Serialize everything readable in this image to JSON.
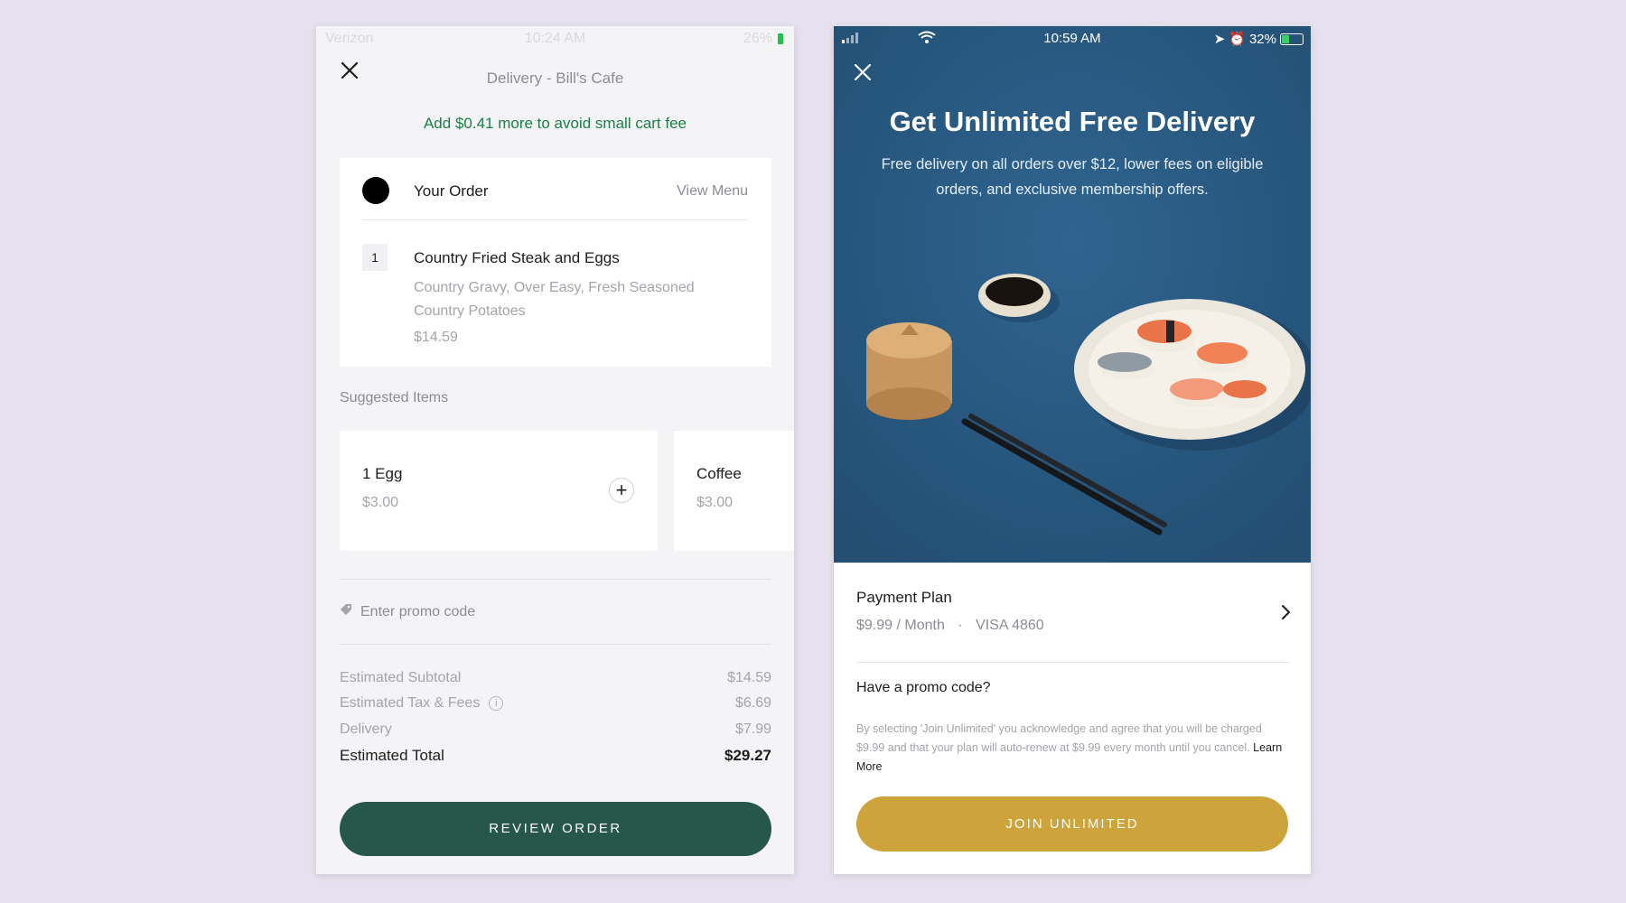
{
  "left": {
    "status": {
      "carrier": "Verizon",
      "time": "10:24 AM",
      "battery": "26%"
    },
    "title": "Delivery - Bill's Cafe",
    "banner": "Add $0.41 more to avoid small cart fee",
    "order": {
      "heading": "Your Order",
      "view_menu": "View Menu",
      "item": {
        "qty": "1",
        "name": "Country Fried Steak and Eggs",
        "desc": "Country Gravy, Over Easy, Fresh Seasoned Country Potatoes",
        "price": "$14.59"
      }
    },
    "suggested_label": "Suggested Items",
    "suggested": [
      {
        "name": "1 Egg",
        "price": "$3.00"
      },
      {
        "name": "Coffee",
        "price": "$3.00"
      }
    ],
    "promo_placeholder": "Enter promo code",
    "summary": {
      "subtotal_label": "Estimated Subtotal",
      "subtotal": "$14.59",
      "tax_label": "Estimated Tax & Fees",
      "tax": "$6.69",
      "delivery_label": "Delivery",
      "delivery": "$7.99",
      "total_label": "Estimated Total",
      "total": "$29.27"
    },
    "review_button": "REVIEW ORDER"
  },
  "right": {
    "status": {
      "time": "10:59 AM",
      "battery": "32%"
    },
    "headline": "Get Unlimited Free Delivery",
    "subhead": "Free delivery on all orders over $12, lower fees on eligible orders, and exclusive membership offers.",
    "payment": {
      "label": "Payment Plan",
      "price": "$9.99 / Month",
      "separator": "·",
      "card": "VISA 4860"
    },
    "promo_question": "Have a promo code?",
    "legal": "By selecting 'Join Unlimited' you acknowledge and agree that you will be charged $9.99 and that your plan will auto-renew at $9.99 every month until you cancel.",
    "learn_more": "Learn More",
    "join_button": "JOIN UNLIMITED"
  },
  "colors": {
    "background": "#e6e1ee",
    "primary_green": "#27574a",
    "banner_green": "#1a7f46",
    "hero_blue": "#2a5a80",
    "gold": "#cda43b"
  }
}
